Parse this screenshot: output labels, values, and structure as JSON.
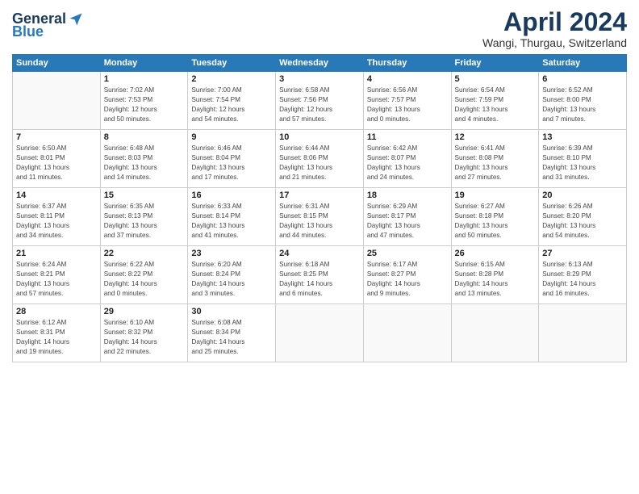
{
  "header": {
    "logo_general": "General",
    "logo_blue": "Blue",
    "month_title": "April 2024",
    "location": "Wangi, Thurgau, Switzerland"
  },
  "calendar": {
    "days_of_week": [
      "Sunday",
      "Monday",
      "Tuesday",
      "Wednesday",
      "Thursday",
      "Friday",
      "Saturday"
    ],
    "weeks": [
      [
        {
          "day": "",
          "info": ""
        },
        {
          "day": "1",
          "info": "Sunrise: 7:02 AM\nSunset: 7:53 PM\nDaylight: 12 hours\nand 50 minutes."
        },
        {
          "day": "2",
          "info": "Sunrise: 7:00 AM\nSunset: 7:54 PM\nDaylight: 12 hours\nand 54 minutes."
        },
        {
          "day": "3",
          "info": "Sunrise: 6:58 AM\nSunset: 7:56 PM\nDaylight: 12 hours\nand 57 minutes."
        },
        {
          "day": "4",
          "info": "Sunrise: 6:56 AM\nSunset: 7:57 PM\nDaylight: 13 hours\nand 0 minutes."
        },
        {
          "day": "5",
          "info": "Sunrise: 6:54 AM\nSunset: 7:59 PM\nDaylight: 13 hours\nand 4 minutes."
        },
        {
          "day": "6",
          "info": "Sunrise: 6:52 AM\nSunset: 8:00 PM\nDaylight: 13 hours\nand 7 minutes."
        }
      ],
      [
        {
          "day": "7",
          "info": "Sunrise: 6:50 AM\nSunset: 8:01 PM\nDaylight: 13 hours\nand 11 minutes."
        },
        {
          "day": "8",
          "info": "Sunrise: 6:48 AM\nSunset: 8:03 PM\nDaylight: 13 hours\nand 14 minutes."
        },
        {
          "day": "9",
          "info": "Sunrise: 6:46 AM\nSunset: 8:04 PM\nDaylight: 13 hours\nand 17 minutes."
        },
        {
          "day": "10",
          "info": "Sunrise: 6:44 AM\nSunset: 8:06 PM\nDaylight: 13 hours\nand 21 minutes."
        },
        {
          "day": "11",
          "info": "Sunrise: 6:42 AM\nSunset: 8:07 PM\nDaylight: 13 hours\nand 24 minutes."
        },
        {
          "day": "12",
          "info": "Sunrise: 6:41 AM\nSunset: 8:08 PM\nDaylight: 13 hours\nand 27 minutes."
        },
        {
          "day": "13",
          "info": "Sunrise: 6:39 AM\nSunset: 8:10 PM\nDaylight: 13 hours\nand 31 minutes."
        }
      ],
      [
        {
          "day": "14",
          "info": "Sunrise: 6:37 AM\nSunset: 8:11 PM\nDaylight: 13 hours\nand 34 minutes."
        },
        {
          "day": "15",
          "info": "Sunrise: 6:35 AM\nSunset: 8:13 PM\nDaylight: 13 hours\nand 37 minutes."
        },
        {
          "day": "16",
          "info": "Sunrise: 6:33 AM\nSunset: 8:14 PM\nDaylight: 13 hours\nand 41 minutes."
        },
        {
          "day": "17",
          "info": "Sunrise: 6:31 AM\nSunset: 8:15 PM\nDaylight: 13 hours\nand 44 minutes."
        },
        {
          "day": "18",
          "info": "Sunrise: 6:29 AM\nSunset: 8:17 PM\nDaylight: 13 hours\nand 47 minutes."
        },
        {
          "day": "19",
          "info": "Sunrise: 6:27 AM\nSunset: 8:18 PM\nDaylight: 13 hours\nand 50 minutes."
        },
        {
          "day": "20",
          "info": "Sunrise: 6:26 AM\nSunset: 8:20 PM\nDaylight: 13 hours\nand 54 minutes."
        }
      ],
      [
        {
          "day": "21",
          "info": "Sunrise: 6:24 AM\nSunset: 8:21 PM\nDaylight: 13 hours\nand 57 minutes."
        },
        {
          "day": "22",
          "info": "Sunrise: 6:22 AM\nSunset: 8:22 PM\nDaylight: 14 hours\nand 0 minutes."
        },
        {
          "day": "23",
          "info": "Sunrise: 6:20 AM\nSunset: 8:24 PM\nDaylight: 14 hours\nand 3 minutes."
        },
        {
          "day": "24",
          "info": "Sunrise: 6:18 AM\nSunset: 8:25 PM\nDaylight: 14 hours\nand 6 minutes."
        },
        {
          "day": "25",
          "info": "Sunrise: 6:17 AM\nSunset: 8:27 PM\nDaylight: 14 hours\nand 9 minutes."
        },
        {
          "day": "26",
          "info": "Sunrise: 6:15 AM\nSunset: 8:28 PM\nDaylight: 14 hours\nand 13 minutes."
        },
        {
          "day": "27",
          "info": "Sunrise: 6:13 AM\nSunset: 8:29 PM\nDaylight: 14 hours\nand 16 minutes."
        }
      ],
      [
        {
          "day": "28",
          "info": "Sunrise: 6:12 AM\nSunset: 8:31 PM\nDaylight: 14 hours\nand 19 minutes."
        },
        {
          "day": "29",
          "info": "Sunrise: 6:10 AM\nSunset: 8:32 PM\nDaylight: 14 hours\nand 22 minutes."
        },
        {
          "day": "30",
          "info": "Sunrise: 6:08 AM\nSunset: 8:34 PM\nDaylight: 14 hours\nand 25 minutes."
        },
        {
          "day": "",
          "info": ""
        },
        {
          "day": "",
          "info": ""
        },
        {
          "day": "",
          "info": ""
        },
        {
          "day": "",
          "info": ""
        }
      ]
    ]
  }
}
